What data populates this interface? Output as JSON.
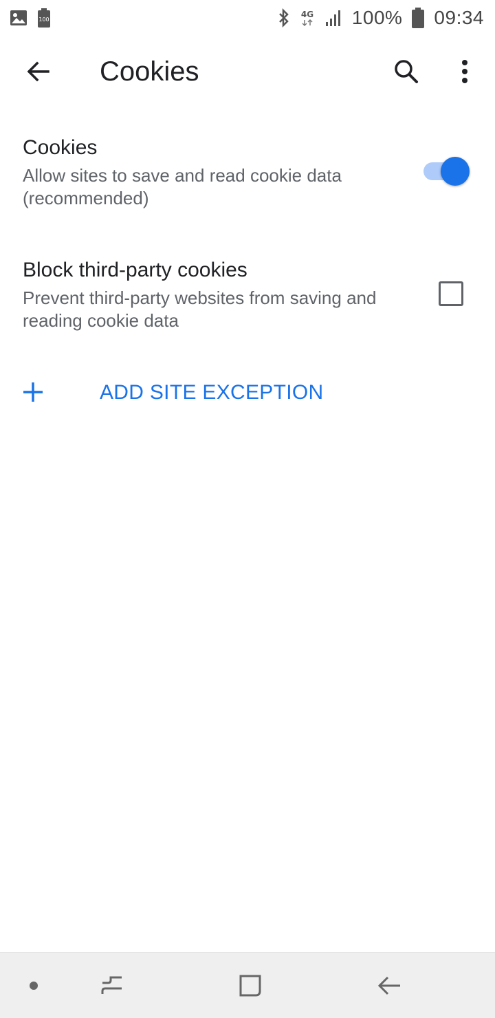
{
  "status_bar": {
    "battery_percent": "100%",
    "time": "09:34",
    "network": "4G",
    "left_icons": [
      "image-icon",
      "battery-saver-icon"
    ],
    "right_icons": [
      "bluetooth-icon",
      "network-4g-icon",
      "signal-icon",
      "battery-icon"
    ],
    "battery_saver_badge": "100"
  },
  "toolbar": {
    "title": "Cookies",
    "back_icon": "arrow-back-icon",
    "search_icon": "search-icon",
    "more_icon": "more-vert-icon"
  },
  "settings": {
    "cookies": {
      "title": "Cookies",
      "subtitle": "Allow sites to save and read cookie data (recommended)",
      "enabled": true
    },
    "block_third_party": {
      "title": "Block third-party cookies",
      "subtitle": "Prevent third-party websites from saving and reading cookie data",
      "checked": false
    },
    "add_exception": {
      "label": "ADD SITE EXCEPTION",
      "icon": "plus-icon"
    }
  },
  "nav_bar": {
    "buttons": [
      "dot-icon",
      "recents-icon",
      "home-icon",
      "back-icon"
    ]
  },
  "colors": {
    "accent": "#1a73e8",
    "accent_light": "#aecbfa",
    "text_primary": "#202124",
    "text_secondary": "#5f6368",
    "nav_background": "#efefef"
  }
}
